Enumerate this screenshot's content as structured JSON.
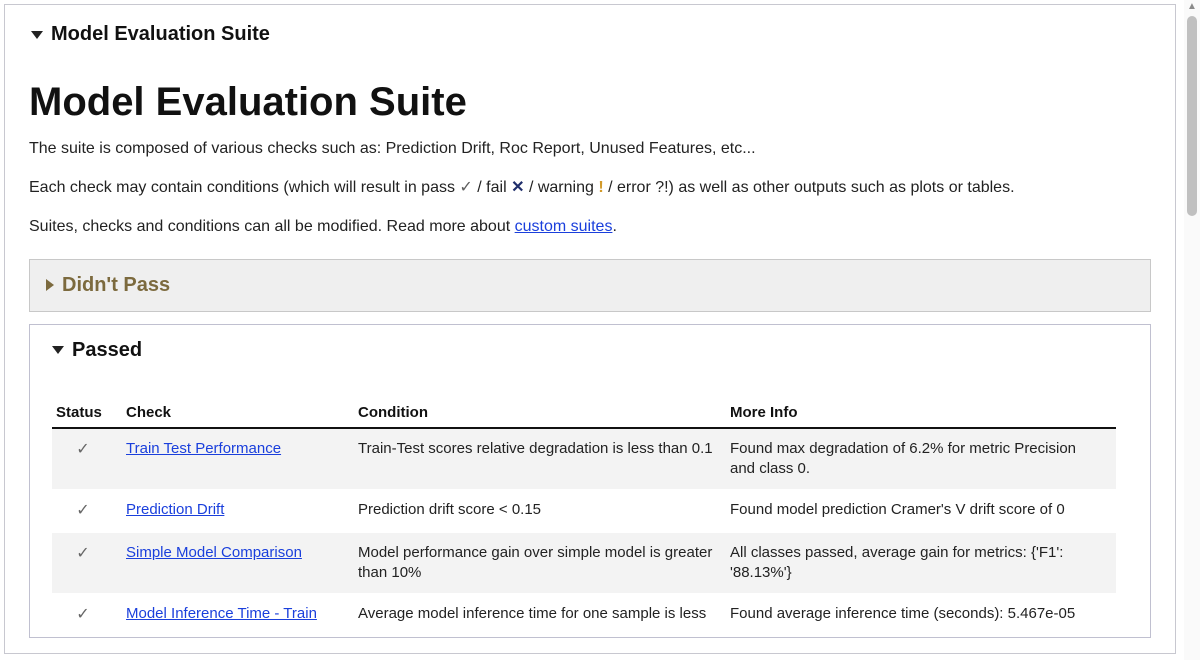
{
  "top_section_title": "Model Evaluation Suite",
  "page_title": "Model Evaluation Suite",
  "intro_line1": "The suite is composed of various checks such as: Prediction Drift, Roc Report, Unused Features, etc...",
  "intro_line2_a": "Each check may contain conditions (which will result in pass ",
  "intro_line2_pass_sym": "✓",
  "intro_line2_b": " / fail ",
  "intro_line2_fail_sym": "✕",
  "intro_line2_c": " / warning ",
  "intro_line2_warn_sym": "!",
  "intro_line2_d": " / error ?!) as well as other outputs such as plots or tables.",
  "intro_line3_a": "Suites, checks and conditions can all be modified. Read more about ",
  "intro_custom_suites_link": "custom suites",
  "intro_line3_b": ".",
  "closed_section_title": "Didn't Pass",
  "open_section_title": "Passed",
  "columns": {
    "status": "Status",
    "check": "Check",
    "condition": "Condition",
    "more": "More Info"
  },
  "rows": [
    {
      "status": "✓",
      "check": "Train Test Performance",
      "condition": "Train-Test scores relative degradation is less than 0.1",
      "more": "Found max degradation of 6.2% for metric Precision and class 0."
    },
    {
      "status": "✓",
      "check": "Prediction Drift",
      "condition": "Prediction drift score < 0.15",
      "more": "Found model prediction Cramer's V drift score of 0"
    },
    {
      "status": "✓",
      "check": "Simple Model Comparison",
      "condition": "Model performance gain over simple model is greater than 10%",
      "more": "All classes passed, average gain for metrics: {'F1': '88.13%'}"
    },
    {
      "status": "✓",
      "check": "Model Inference Time - Train",
      "condition": "Average model inference time for one sample is less",
      "more": "Found average inference time (seconds): 5.467e-05"
    }
  ]
}
